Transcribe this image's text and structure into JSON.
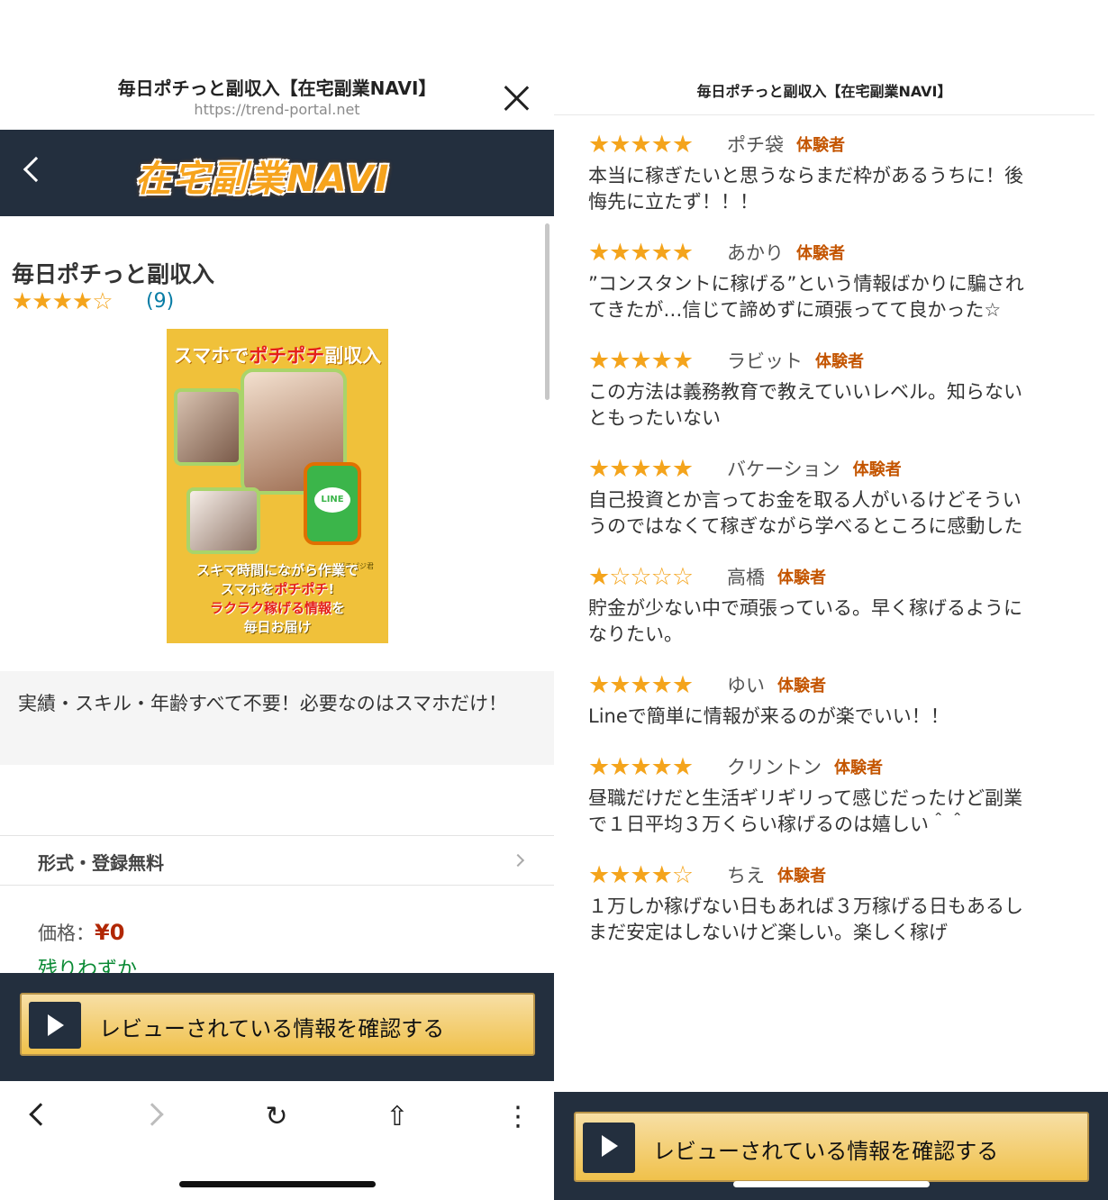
{
  "left": {
    "window_title": "毎日ポチっと副収入【在宅副業NAVI】",
    "url": "https://trend-portal.net",
    "logo_text": "在宅副業NAVI",
    "product_title": "毎日ポチっと副収入",
    "rating_stars": "★★★★☆",
    "rating_value": 4.5,
    "rating_count": "(9)",
    "cover": {
      "headline_prefix": "スマホで",
      "headline_highlight": "ポチポチ",
      "headline_suffix": "副収入",
      "phone_label": "LINE",
      "mascot_label": "ポチピジ君",
      "caption_line1": "スキマ時間にながら作業で",
      "caption_line2a": "スマホを",
      "caption_line2b": "ポチポチ",
      "caption_line2c": "!",
      "caption_line3a": "ラクラク稼げる情報",
      "caption_line3b": "を",
      "caption_line4": "毎日お届け"
    },
    "description": "実績・スキル・年齢すべて不要！必要なのはスマホだけ！",
    "format_label": "形式・登録無料",
    "price_label": "価格：",
    "price_value": "¥0",
    "stock_text": "残りわずか",
    "cta_label": "レビューされている情報を確認する",
    "browser": {
      "back": "‹",
      "forward": "›",
      "reload": "↻",
      "share": "⇧",
      "more": "⋮"
    }
  },
  "right": {
    "window_title": "毎日ポチっと副収入【在宅副業NAVI】",
    "badge_text": "体験者",
    "reviews": [
      {
        "stars": "★★★★★",
        "rating": 5,
        "name": "ポチ袋",
        "body": "本当に稼ぎたいと思うならまだ枠があるうちに！後悔先に立たず！！！"
      },
      {
        "stars": "★★★★★",
        "rating": 5,
        "name": "あかり",
        "body": "”コンスタントに稼げる”という情報ばかりに騙されてきたが…信じて諦めずに頑張ってて良かった☆"
      },
      {
        "stars": "★★★★★",
        "rating": 5,
        "name": "ラビット",
        "body": "この方法は義務教育で教えていいレベル。知らないともったいない"
      },
      {
        "stars": "★★★★★",
        "rating": 5,
        "name": "バケーション",
        "body": "自己投資とか言ってお金を取る人がいるけどそういうのではなくて稼ぎながら学べるところに感動した"
      },
      {
        "stars": "★☆☆☆☆",
        "rating": 1,
        "name": "高橋",
        "body": "貯金が少ない中で頑張っている。早く稼げるようになりたい。"
      },
      {
        "stars": "★★★★★",
        "rating": 5,
        "name": "ゆい",
        "body": "Lineで簡単に情報が来るのが楽でいい！！"
      },
      {
        "stars": "★★★★★",
        "rating": 5,
        "name": "クリントン",
        "body": "昼職だけだと生活ギリギリって感じだったけど副業で１日平均３万くらい稼げるのは嬉しい＾＾"
      },
      {
        "stars": "★★★★☆",
        "rating": 4,
        "name": "ちえ",
        "body": "１万しか稼げない日もあれば３万稼げる日もあるしまだ安定はしないけど楽しい。楽しく稼げ"
      }
    ],
    "cta_label": "レビューされている情報を確認する"
  }
}
